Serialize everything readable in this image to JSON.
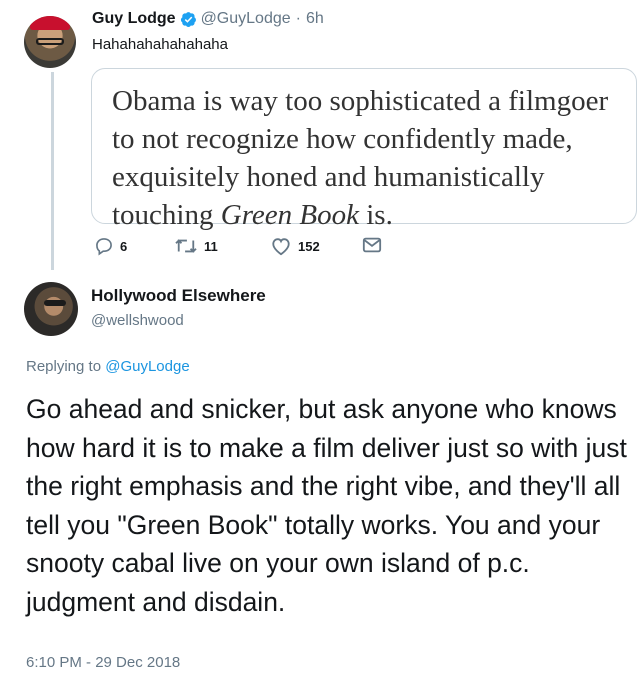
{
  "tweet1": {
    "author_name": "Guy Lodge",
    "author_handle": "@GuyLodge",
    "separator": "·",
    "time_ago": "6h",
    "text": "Hahahahahahahaha",
    "quote": {
      "line_before_italic": "Obama is way too sophisticated a filmgoer to not recognize how confidently made, exquisitely honed and humanistically touching ",
      "italic": "Green Book",
      "line_after_italic": " is."
    },
    "actions": {
      "reply_icon": "reply-icon",
      "reply_count": "6",
      "retweet_icon": "retweet-icon",
      "retweet_count": "11",
      "like_icon": "heart-icon",
      "like_count": "152",
      "dm_icon": "envelope-icon"
    }
  },
  "tweet2": {
    "author_name": "Hollywood Elsewhere",
    "author_handle": "@wellshwood",
    "replying_prefix": "Replying to",
    "replying_to": "@GuyLodge",
    "text": "Go ahead and snicker, but ask anyone who knows how hard it is to make a film deliver just so with just the right emphasis and the right vibe, and they'll all tell you \"Green Book\" totally works.  You and your snooty cabal live on your own island of p.c. judgment and disdain.",
    "timestamp": "6:10 PM - 29 Dec 2018"
  },
  "colors": {
    "verified_blue": "#1da1f2",
    "link_blue": "#1b95e0",
    "secondary_gray": "#657786",
    "thread_line": "#ccd6dd"
  }
}
